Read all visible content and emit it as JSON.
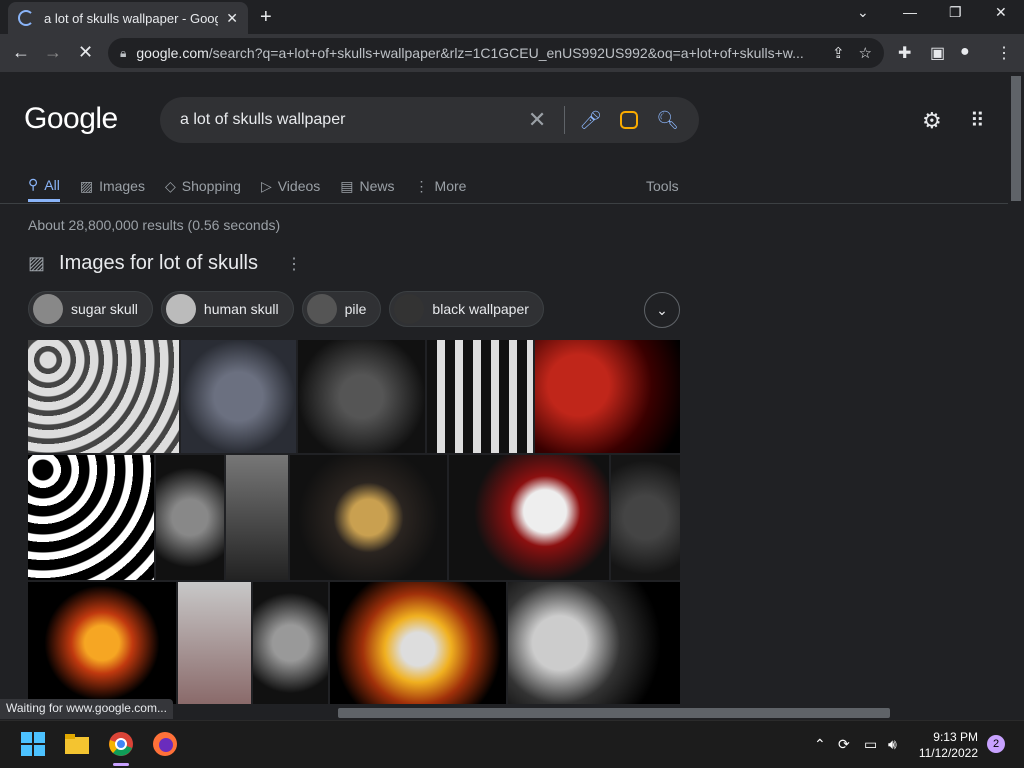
{
  "browser": {
    "tab_title": "a lot of skulls wallpaper - Google",
    "url_host": "google.com",
    "url_rest": "/search?q=a+lot+of+skulls+wallpaper&rlz=1C1GCEU_enUS992US992&oq=a+lot+of+skulls+w..."
  },
  "google": {
    "logo": "Google",
    "query": "a lot of skulls wallpaper",
    "tabs": [
      {
        "label": "All",
        "icon": "search-icon"
      },
      {
        "label": "Images",
        "icon": "image-icon"
      },
      {
        "label": "Shopping",
        "icon": "tag-icon"
      },
      {
        "label": "Videos",
        "icon": "play-icon"
      },
      {
        "label": "News",
        "icon": "news-icon"
      },
      {
        "label": "More",
        "icon": "more-icon"
      }
    ],
    "tools": "Tools",
    "stats": "About 28,800,000 results (0.56 seconds)",
    "images_heading": "Images for lot of skulls",
    "chips": [
      "sugar skull",
      "human skull",
      "pile",
      "black wallpaper"
    ]
  },
  "status_bar": "Waiting for www.google.com...",
  "taskbar": {
    "time": "9:13 PM",
    "date": "11/12/2022",
    "notifications": "2"
  },
  "colors": {
    "accent": "#8ab4f8",
    "background": "#202124"
  }
}
